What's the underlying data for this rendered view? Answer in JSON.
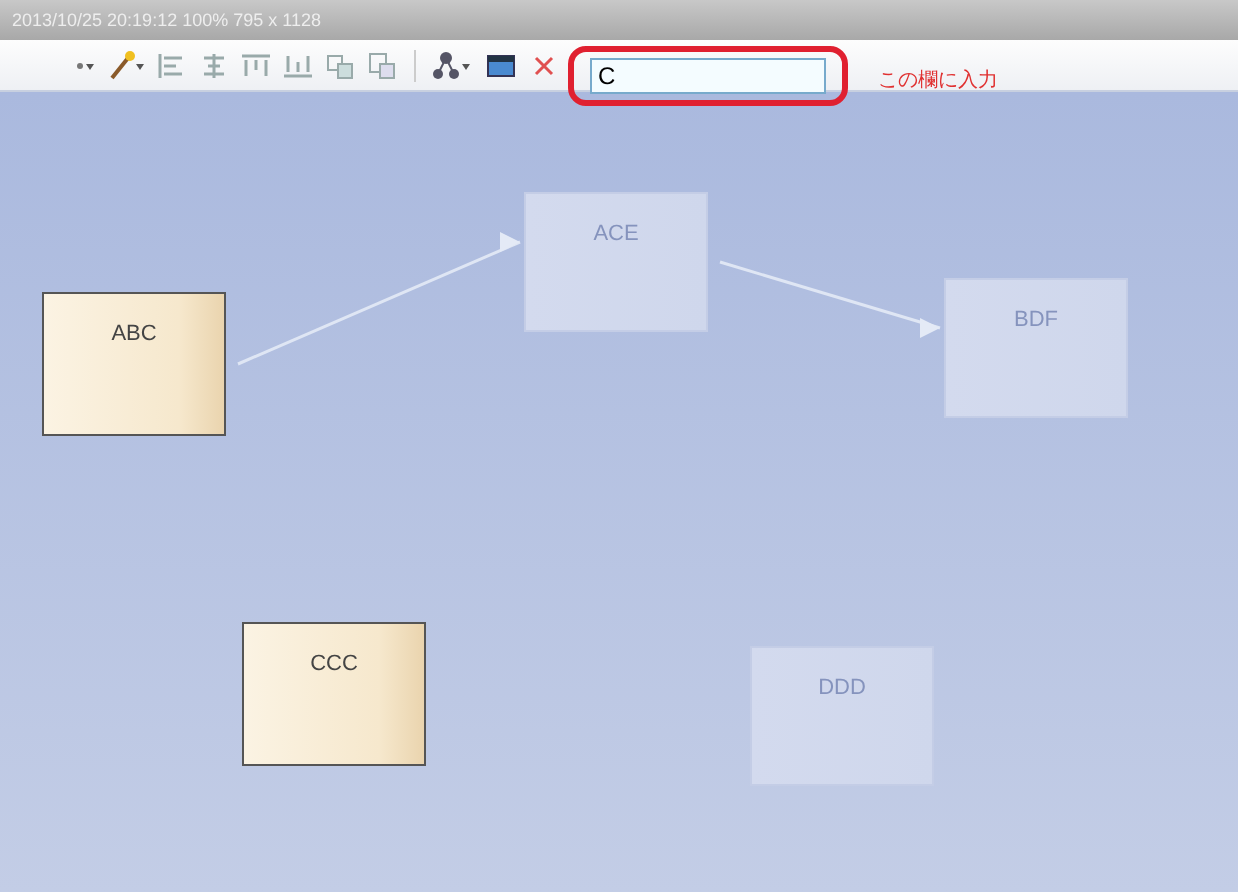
{
  "title_bar": {
    "text": "2013/10/25 20:19:12  100%  795 x 1128"
  },
  "toolbar": {
    "search": {
      "value": "C"
    },
    "annotation": "この欄に入力"
  },
  "nodes": [
    {
      "label": "ABC",
      "highlighted": true
    },
    {
      "label": "ACE",
      "highlighted": false
    },
    {
      "label": "BDF",
      "highlighted": false
    },
    {
      "label": "CCC",
      "highlighted": true
    },
    {
      "label": "DDD",
      "highlighted": false
    }
  ]
}
